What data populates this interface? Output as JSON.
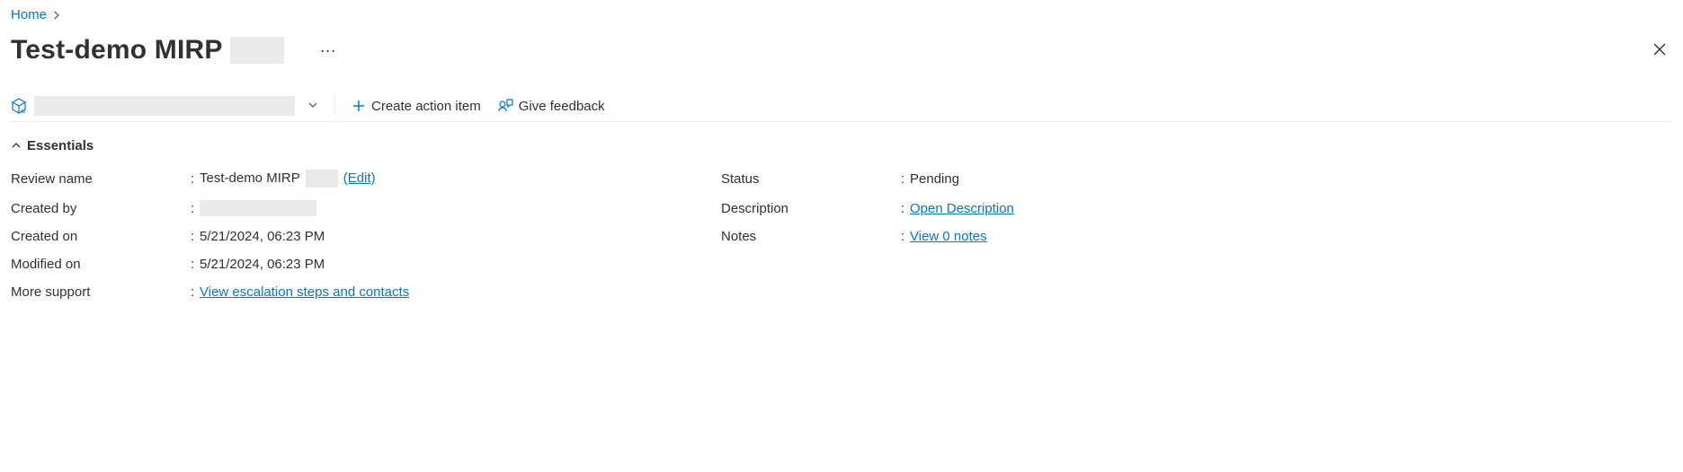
{
  "breadcrumb": {
    "home": "Home"
  },
  "page": {
    "title": "Test-demo MIRP"
  },
  "toolbar": {
    "create_action_item": "Create action item",
    "give_feedback": "Give feedback"
  },
  "essentials": {
    "header": "Essentials",
    "review_name_label": "Review name",
    "review_name_value": "Test-demo MIRP",
    "edit": "(Edit)",
    "created_by_label": "Created by",
    "created_on_label": "Created on",
    "created_on_value": "5/21/2024, 06:23 PM",
    "modified_on_label": "Modified on",
    "modified_on_value": "5/21/2024, 06:23 PM",
    "more_support_label": "More support",
    "more_support_link": "View escalation steps and contacts",
    "status_label": "Status",
    "status_value": "Pending",
    "description_label": "Description",
    "description_link": "Open Description",
    "notes_label": "Notes",
    "notes_link": "View 0 notes"
  }
}
